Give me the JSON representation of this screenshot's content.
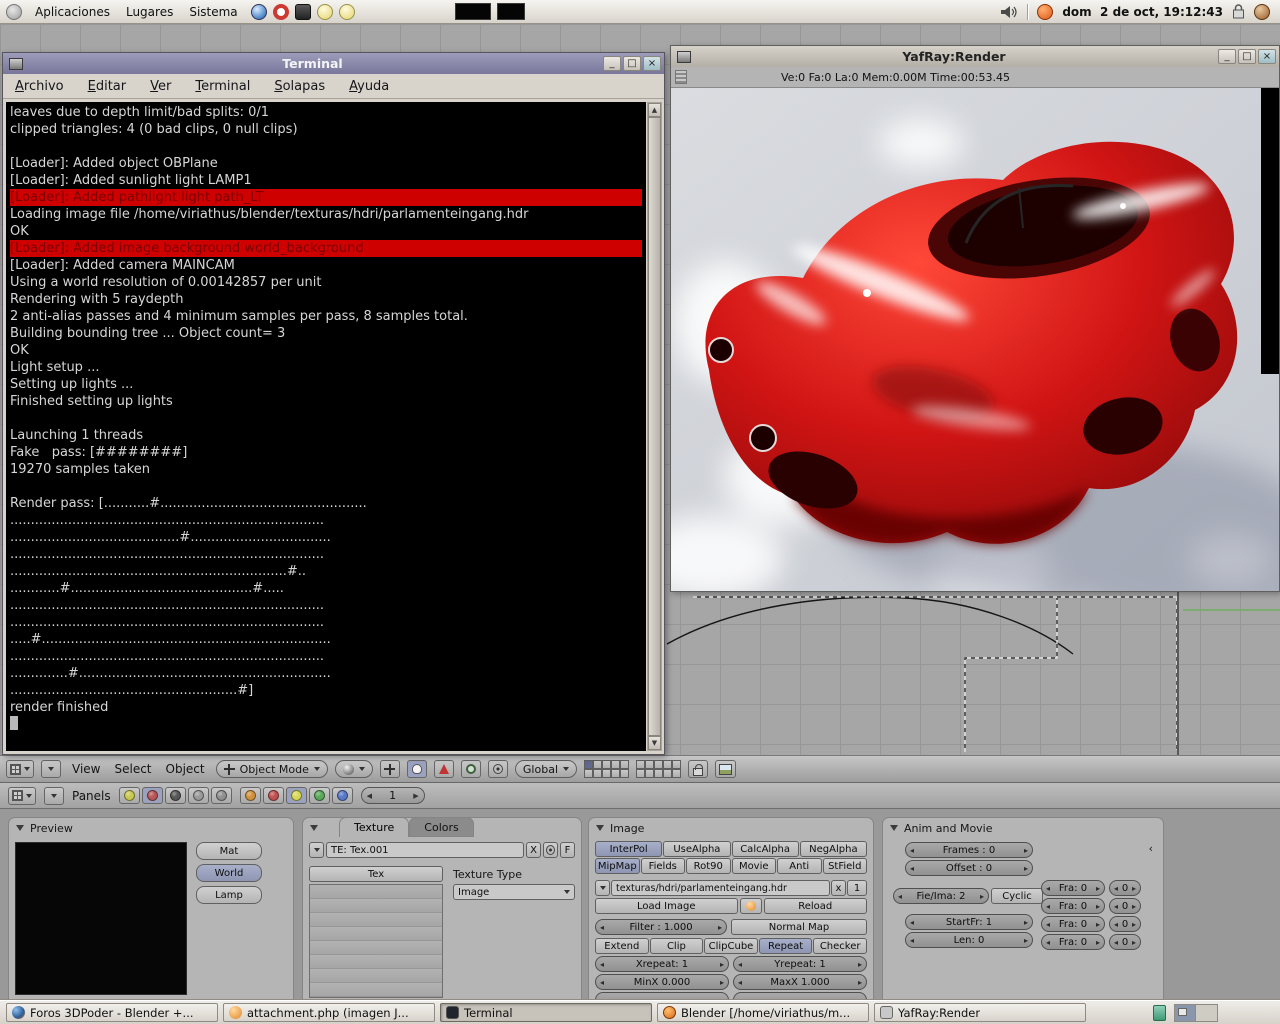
{
  "top_panel": {
    "menus": [
      "Aplicaciones",
      "Lugares",
      "Sistema"
    ],
    "clock": "dom  2 de oct, 19:12:43"
  },
  "window_buttons": [
    {
      "name": "minimize-button",
      "glyph": "_"
    },
    {
      "name": "maximize-button",
      "glyph": "□"
    },
    {
      "name": "close-button",
      "glyph": "×"
    }
  ],
  "terminal": {
    "title": "Terminal",
    "menus": [
      "Archivo",
      "Editar",
      "Ver",
      "Terminal",
      "Solapas",
      "Ayuda"
    ],
    "lines": [
      {
        "t": "leaves due to depth limit/bad splits: 0/1"
      },
      {
        "t": "clipped triangles: 4 (0 bad clips, 0 null clips)"
      },
      {
        "t": ""
      },
      {
        "t": "[Loader]: Added object OBPlane"
      },
      {
        "t": "[Loader]: Added sunlight light LAMP1"
      },
      {
        "t": "[Loader]: Added pathlight light path_LT",
        "h": true
      },
      {
        "t": "Loading image file /home/viriathus/blender/texturas/hdri/parlamenteingang.hdr"
      },
      {
        "t": "OK"
      },
      {
        "t": "[Loader]: Added image background world_background",
        "h": true
      },
      {
        "t": "[Loader]: Added camera MAINCAM"
      },
      {
        "t": "Using a world resolution of 0.00142857 per unit"
      },
      {
        "t": "Rendering with 5 raydepth"
      },
      {
        "t": "2 anti-alias passes and 4 minimum samples per pass, 8 samples total."
      },
      {
        "t": "Building bounding tree ... Object count= 3"
      },
      {
        "t": "OK"
      },
      {
        "t": "Light setup ..."
      },
      {
        "t": "Setting up lights ..."
      },
      {
        "t": "Finished setting up lights"
      },
      {
        "t": ""
      },
      {
        "t": "Launching 1 threads"
      },
      {
        "t": "Fake   pass: [########]"
      },
      {
        "t": "19270 samples taken"
      },
      {
        "t": ""
      },
      {
        "t": "Render pass: [...........#.................................................."
      },
      {
        "t": "............................................................................"
      },
      {
        "t": ".........................................#.................................."
      },
      {
        "t": "............................................................................"
      },
      {
        "t": "...................................................................#.."
      },
      {
        "t": "............#............................................#....."
      },
      {
        "t": "............................................................................"
      },
      {
        "t": "............................................................................"
      },
      {
        "t": ".....#......................................................................"
      },
      {
        "t": "............................................................................"
      },
      {
        "t": "..............#............................................................."
      },
      {
        "t": ".......................................................#]"
      },
      {
        "t": "render finished"
      }
    ]
  },
  "yafray": {
    "title": "YafRay:Render",
    "stats": "Ve:0 Fa:0 La:0 Mem:0.00M Time:00:53.45"
  },
  "blender": {
    "header": {
      "menus": [
        "View",
        "Select",
        "Object"
      ],
      "mode": "Object Mode",
      "space": "Global",
      "active_layer": 0
    },
    "buttons_header": {
      "panels": "Panels",
      "frame": "1",
      "icon_groups": [
        {
          "name": "window-type-icons",
          "icons": [
            {
              "name": "logic-icon",
              "color": "#c8c851"
            },
            {
              "name": "shading-icon",
              "color": "#b85555",
              "on": true
            },
            {
              "name": "script-icon",
              "color": "#565656"
            },
            {
              "name": "editing-icon",
              "color": "#9a9a9a"
            },
            {
              "name": "scene-icon",
              "color": "#8f8f8f"
            }
          ]
        },
        {
          "name": "shading-subtype-icons",
          "icons": [
            {
              "name": "lamp-icon",
              "color": "#d0913c"
            },
            {
              "name": "material-icon",
              "color": "#c05050"
            },
            {
              "name": "texture-icon",
              "color": "#d8d858",
              "on": true
            },
            {
              "name": "radiosity-icon",
              "color": "#58a858"
            },
            {
              "name": "world-icon",
              "color": "#5878c8"
            }
          ]
        }
      ]
    },
    "preview_panel": {
      "title": "Preview",
      "buttons": [
        {
          "label": "Mat"
        },
        {
          "label": "World",
          "on": true
        },
        {
          "label": "Lamp"
        }
      ]
    },
    "texture_panel": {
      "tab_texture": "Texture",
      "tab_colors": "Colors",
      "name_field": "TE: Tex.001",
      "delete": "X",
      "fake_user": "F",
      "list_header": "Tex",
      "type_label": "Texture Type",
      "type_value": "Image"
    },
    "image_panel": {
      "title": "Image",
      "row1": [
        {
          "label": "InterPol",
          "on": true
        },
        {
          "label": "UseAlpha"
        },
        {
          "label": "CalcAlpha"
        },
        {
          "label": "NegAlpha"
        }
      ],
      "row2": [
        {
          "label": "MipMap",
          "on": true
        },
        {
          "label": "Fields"
        },
        {
          "label": "Rot90"
        },
        {
          "label": "Movie"
        },
        {
          "label": "Anti"
        },
        {
          "label": "StField"
        }
      ],
      "path": "texturas/hdri/parlamenteingang.hdr",
      "delete": "x",
      "users": "1",
      "load": "Load Image",
      "reload": "Reload",
      "filter": "Filter : 1.000",
      "normal_map": "Normal Map",
      "row3": [
        {
          "label": "Extend"
        },
        {
          "label": "Clip"
        },
        {
          "label": "ClipCube"
        },
        {
          "label": "Repeat",
          "on": true
        },
        {
          "label": "Checker"
        }
      ],
      "xrepeat": "Xrepeat: 1",
      "yrepeat": "Yrepeat: 1",
      "minx": "MinX 0.000",
      "maxx": "MaxX 1.000"
    },
    "anim_panel": {
      "title": "Anim and Movie",
      "frames": "Frames : 0",
      "offset": "Offset : 0",
      "fie_ima": "Fie/Ima: 2",
      "cyclic": "Cyclic",
      "startfr": "StartFr: 1",
      "len": "Len: 0",
      "fra_rows": [
        {
          "fra": "Fra: 0",
          "n": "0"
        },
        {
          "fra": "Fra: 0",
          "n": "0"
        },
        {
          "fra": "Fra: 0",
          "n": "0"
        },
        {
          "fra": "Fra: 0",
          "n": "0"
        }
      ]
    }
  },
  "taskbar": {
    "tasks": [
      {
        "label": "Foros 3DPoder - Blender +...",
        "icon": "firefox"
      },
      {
        "label": "attachment.php (imagen J...",
        "icon": "image"
      },
      {
        "label": "Terminal",
        "icon": "terminal",
        "active": true
      },
      {
        "label": "Blender [/home/viriathus/m...",
        "icon": "blender"
      },
      {
        "label": "YafRay:Render",
        "icon": "yafray"
      }
    ]
  }
}
